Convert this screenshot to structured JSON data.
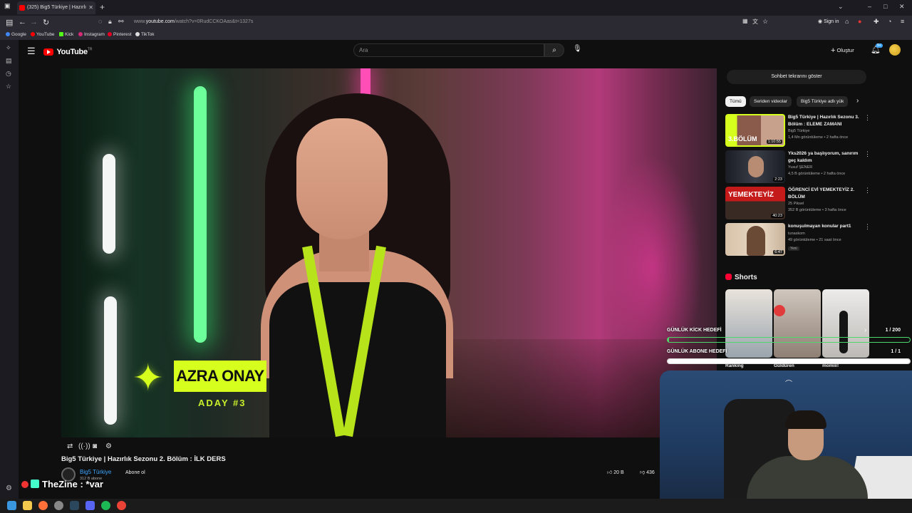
{
  "browser": {
    "tab_title": "(325) Big5 Türkiye | Hazırlı",
    "url_prefix": "www.",
    "url_domain": "youtube.com",
    "url_path": "/watch?v=0RudCCKOAas&t=1327s",
    "sign_in": "Sign in",
    "bookmarks": [
      "Google",
      "YouTube",
      "Kick",
      "Instagram",
      "Pinterest",
      "TikTok"
    ]
  },
  "youtube": {
    "logo": "YouTube",
    "logo_sup": "TR",
    "search_placeholder": "Ara",
    "create_label": "Oluştur",
    "notif_count": "9+"
  },
  "video": {
    "name_card": "AZRA ONAY",
    "aday_label": "ADAY #3",
    "title": "Big5 Türkiye | Hazırlık Sezonu 2. Bölüm : İLK DERS",
    "channel": "Big5 Türkiye",
    "subscribers": "312 B abone",
    "subscribe_label": "Abone ol",
    "likes": "20 B",
    "dislikes": "436"
  },
  "sidebar": {
    "chat_button": "Sohbet tekrarını göster",
    "chips": [
      "Tümü",
      "Seriden videolar",
      "Big5 Türkiye adlı yük"
    ],
    "recommendations": [
      {
        "title": "Big5 Türkiye | Hazırlık Sezonu 3. Bölüm : ELEME ZAMANI",
        "channel": "Big5 Türkiye",
        "meta": "1,4 Mn görüntüleme • 2 hafta önce",
        "duration": "1:10:55",
        "thumb_text": "3.BÖLÜM"
      },
      {
        "title": "Yks2026 ya başlıyorum, sanırım geç kaldım",
        "channel": "Yusuf ŞENER",
        "meta": "4,5 B görüntüleme • 2 hafta önce",
        "duration": "2:23",
        "thumb_text": ""
      },
      {
        "title": "ÖĞRENCİ EVİ YEMEKTEYİZ 2. BÖLÜM",
        "channel": "25 Piksel",
        "meta": "352 B görüntüleme • 3 hafta önce",
        "duration": "40:23",
        "thumb_text": "YEMEKTEYİZ"
      },
      {
        "title": "konuşulmayan konular part1",
        "channel": "tunaskom",
        "meta": "49 görüntüleme • 21 saat önce",
        "duration": "6:47",
        "thumb_text": "",
        "badge": "Yeni"
      }
    ],
    "shorts_heading": "Shorts",
    "short_labels": [
      "Ranking",
      "Güldüren",
      "momiii!"
    ]
  },
  "overlay": {
    "kick_goal_label": "GÜNLÜK KİCK HEDEFİ",
    "kick_goal_value": "1 / 200",
    "kick_goal_progress": 0.005,
    "sub_goal_label": "GÜNLÜK ABONE HEDEFİ",
    "sub_goal_value": "1 / 1",
    "sub_goal_progress": 1.0,
    "streamer_name": "TheZine : *var"
  }
}
